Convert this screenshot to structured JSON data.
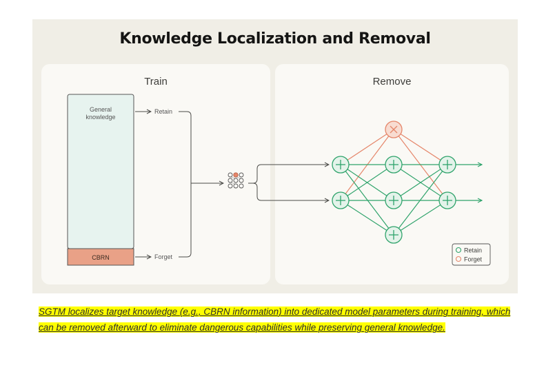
{
  "figure": {
    "title": "Knowledge Localization and Removal",
    "train_panel": {
      "title": "Train",
      "general_label_line1": "General",
      "general_label_line2": "knowledge",
      "cbrn_label": "CBRN",
      "retain_label": "Retain",
      "forget_label": "Forget"
    },
    "remove_panel": {
      "title": "Remove",
      "legend": {
        "retain_label": "Retain",
        "forget_label": "Forget"
      }
    },
    "colors": {
      "retain": "#2fa36b",
      "forget": "#e5866a",
      "cbrn_fill": "#e9a187",
      "general_fill": "#e7f3ef",
      "arrow": "#4a4a47"
    }
  },
  "caption": "SGTM localizes target knowledge (e.g., CBRN information) into dedicated model parameters during training, which can be removed afterward to eliminate dangerous capabilities while preserving general knowledge."
}
